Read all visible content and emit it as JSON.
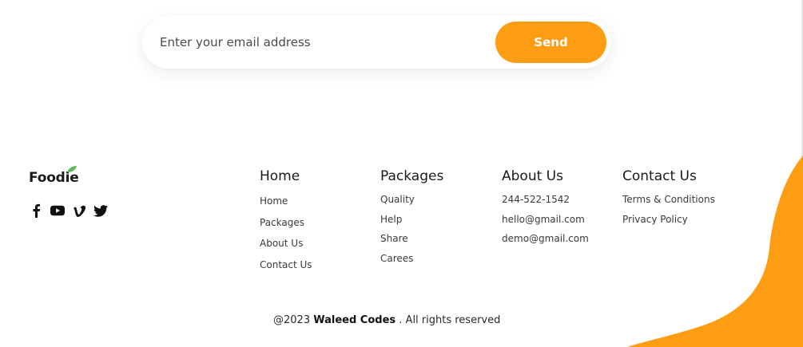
{
  "subscribe": {
    "placeholder": "Enter your email address",
    "send_label": "Send"
  },
  "brand": {
    "logo_text": "Foodie",
    "socials": [
      "facebook-icon",
      "youtube-icon",
      "vimeo-icon",
      "twitter-icon"
    ]
  },
  "columns": [
    {
      "title": "Home",
      "items": [
        "Home",
        "Packages",
        "About Us",
        "Contact Us"
      ]
    },
    {
      "title": "Packages",
      "items": [
        "Quality",
        "Help",
        "Share",
        "Carees"
      ]
    },
    {
      "title": "About Us",
      "items": [
        "244-522-1542",
        "hello@gmail.com",
        "demo@gmail.com"
      ]
    },
    {
      "title": "Contact Us",
      "items": [
        "Terms & Conditions",
        "Privacy Policy"
      ]
    }
  ],
  "copyright": {
    "prefix": "@2023",
    "name": "Waleed Codes",
    "suffix": ". All rights reserved"
  },
  "colors": {
    "accent": "#fd9d14",
    "leaf": "#5cb85c"
  }
}
